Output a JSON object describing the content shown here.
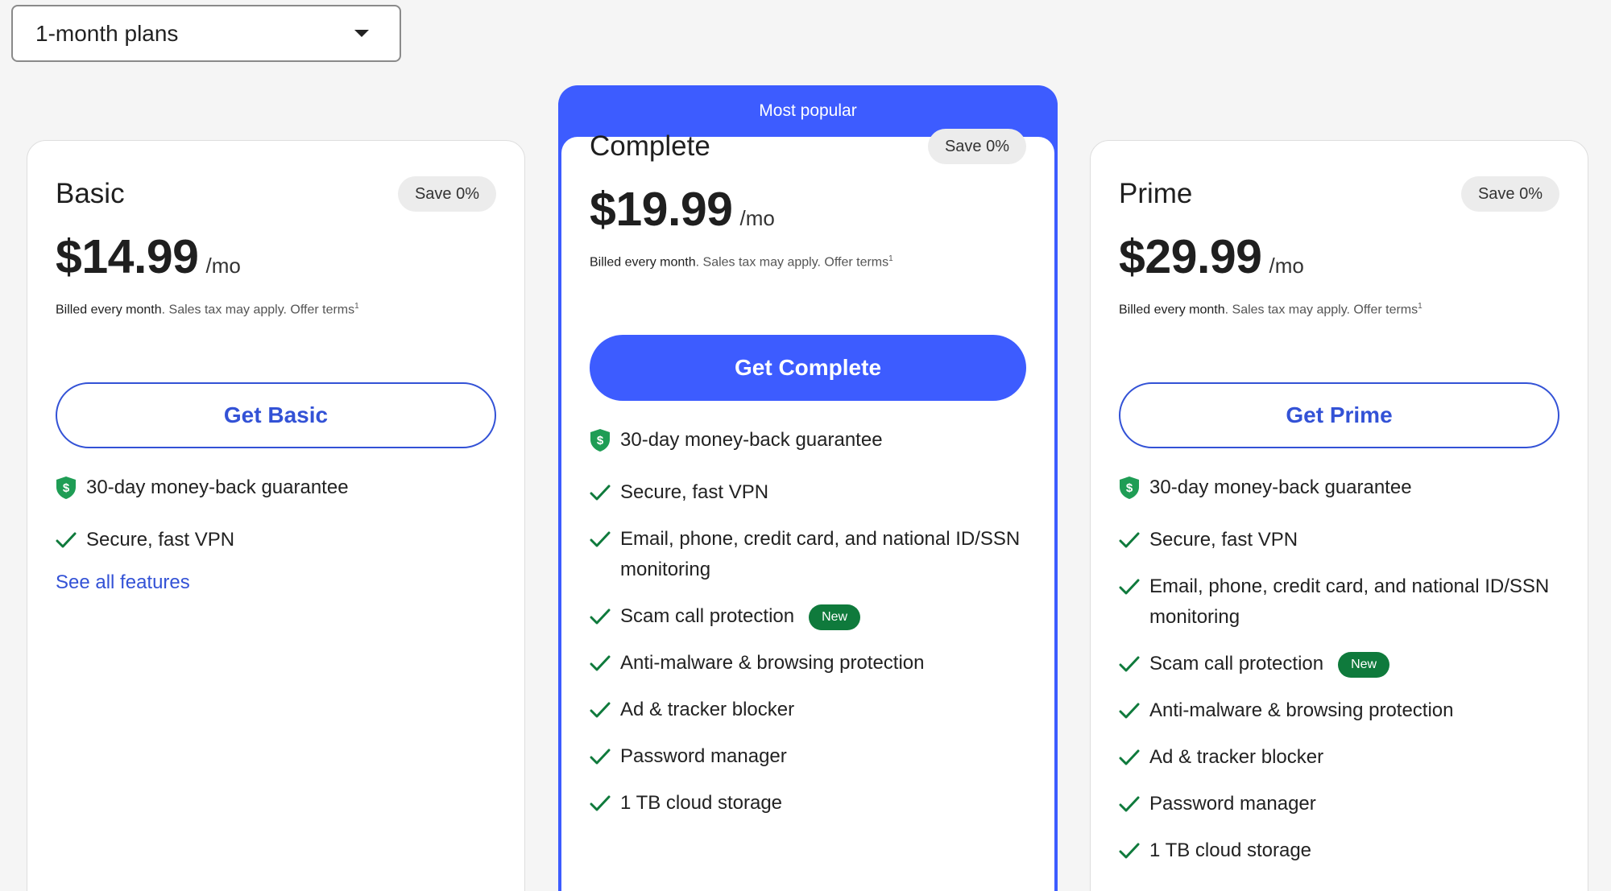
{
  "select": {
    "value": "1-month plans"
  },
  "popular_label": "Most popular",
  "colors": {
    "accent": "#3d5cff",
    "link": "#3352d6",
    "new_badge": "#0f7a3c",
    "shield": "#1f9d55",
    "check": "#0f7a3c"
  },
  "billing": {
    "prefix": "Billed every month",
    "rest": ". Sales tax may apply. Offer terms",
    "sup": "1"
  },
  "plans": [
    {
      "name": "Basic",
      "save": "Save 0%",
      "price": "$14.99",
      "per": "/mo",
      "cta": "Get Basic",
      "guarantee": "30-day money-back guarantee",
      "features": [
        "Secure, fast VPN"
      ],
      "see_all": "See all features"
    },
    {
      "name": "Complete",
      "save": "Save 0%",
      "price": "$19.99",
      "per": "/mo",
      "cta": "Get Complete",
      "guarantee": "30-day money-back guarantee",
      "features": [
        "Secure, fast VPN",
        "Email, phone, credit card, and national ID/SSN monitoring",
        "Scam call protection",
        "Anti-malware & browsing protection",
        "Ad & tracker blocker",
        "Password manager",
        "1 TB cloud storage"
      ],
      "new_label": "New"
    },
    {
      "name": "Prime",
      "save": "Save 0%",
      "price": "$29.99",
      "per": "/mo",
      "cta": "Get Prime",
      "guarantee": "30-day money-back guarantee",
      "features": [
        "Secure, fast VPN",
        "Email, phone, credit card, and national ID/SSN monitoring",
        "Scam call protection",
        "Anti-malware & browsing protection",
        "Ad & tracker blocker",
        "Password manager",
        "1 TB cloud storage"
      ],
      "new_label": "New"
    }
  ]
}
